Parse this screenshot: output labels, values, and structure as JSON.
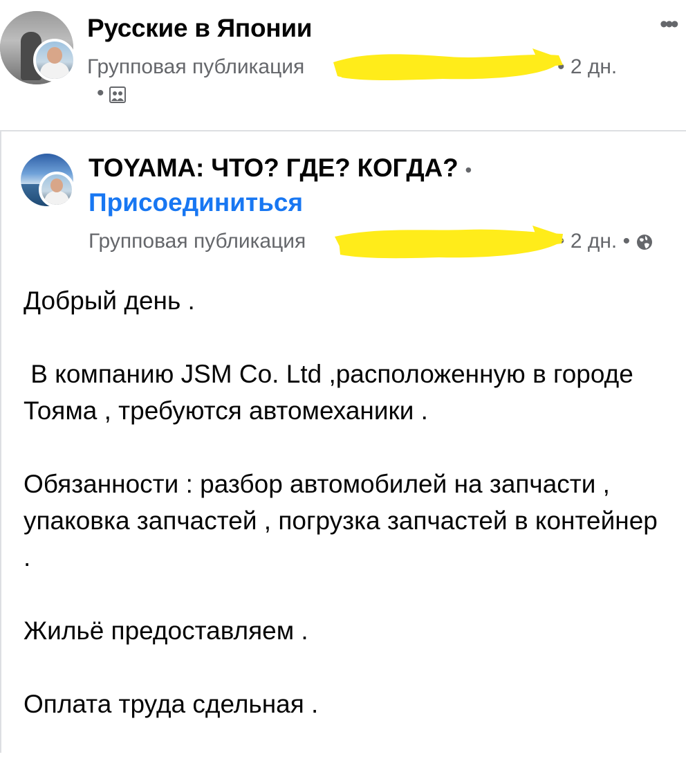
{
  "outer_post": {
    "group_name": "Русские в Японии",
    "meta_label": "Групповая публикация",
    "time": "• 2 дн.",
    "separator_dot": "•",
    "more_icon": "more-dots-icon",
    "group_icon": "group-icon"
  },
  "shared_post": {
    "group_name": "TOYAMA: ЧТО? ГДЕ? КОГДА?",
    "title_dot": "•",
    "join_label": "Присоединиться",
    "meta_label": "Групповая публикация",
    "time": "• 2 дн. •",
    "privacy_icon": "globe-icon",
    "join_color": "#1877f2"
  },
  "post_body": {
    "paragraphs": [
      "Добрый день .",
      " В компанию JSM Co. Ltd ,расположенную в городе Тояма , требуются автомеханики .",
      "Обязанности : разбор автомобилей на запчасти , упаковка запчастей , погрузка запчастей в контейнер .",
      "Жильё предоставляем .",
      "Оплата труда сдельная ."
    ]
  },
  "colors": {
    "text_primary": "#050505",
    "text_secondary": "#65676b",
    "redaction_highlight": "#ffec1a",
    "divider": "#dddfe2"
  }
}
